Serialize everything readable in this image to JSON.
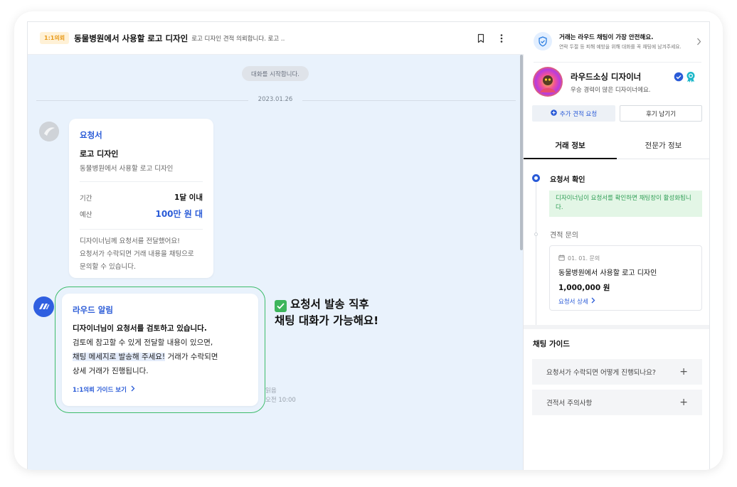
{
  "header": {
    "badge": "1:1의뢰",
    "title": "동물병원에서 사용할 로고 디자인",
    "subtitle": "로고 디자인 견적 의뢰합니다. 로고 .."
  },
  "chat": {
    "start_message": "대화를 시작합니다.",
    "date": "2023.01.26",
    "request_card": {
      "title": "요청서",
      "item": "로고 디자인",
      "description": "동물병원에서 사용할 로고 디자인",
      "period_label": "기간",
      "period_value": "1달 이내",
      "budget_label": "예산",
      "budget_value": "100만 원 대",
      "note_lines": [
        "디자이너님께 요청서를 전달했어요!",
        "요청서가 수락되면 거래 내용을 채팅으로",
        "문의할 수 있습니다."
      ]
    },
    "alert_card": {
      "title": "라우드 알림",
      "line1": "디자이너님이 요청서를 검토하고 있습니다.",
      "line2": "검토에 참고할 수 있게 전달할 내용이 있으면,",
      "line3_highlight": "채팅 메세지로 발송해 주세요!",
      "line3_rest": " 거래가 수락되면",
      "line4": "상세 거래가 진행됩니다.",
      "link": "1:1의뢰 가이드 보기"
    },
    "read_status": "읽음",
    "read_time": "오전 10:00",
    "callout_line1": "요청서 발송 직후",
    "callout_line2": "채팅 대화가 가능해요!"
  },
  "sidebar": {
    "safety_title": "거래는 라우드 채팅이 가장 안전해요.",
    "safety_sub": "연락 두절 등 피해 예방을 위해 대화를 꼭 채팅에 남겨주세요.",
    "profile_name": "라우드소싱 디자이너",
    "profile_sub": "우승 경력이 많은 디자이너에요.",
    "btn_quote": "추가 견적 요청",
    "btn_review": "후기 남기기",
    "tabs": [
      "거래 정보",
      "전문가 정보"
    ],
    "step1_title": "요청서 확인",
    "step1_msg": "디자이너님이 요청서를 확인하면 채팅창이 활성화됩니다.",
    "step2_title": "견적 문의",
    "estimate": {
      "date": "01. 01. 문의",
      "name": "동물병원에서 사용할 로고 디자인",
      "price": "1,000,000 원",
      "link": "요청서 상세"
    },
    "guide_title": "채팅 가이드",
    "faqs": [
      "요청서가 수락되면 어떻게 진행되나요?",
      "견적서 주의사항"
    ]
  },
  "colors": {
    "accent_blue": "#2a5bd7",
    "chat_bg": "#e9f2fc",
    "highlight_green": "#3dbc6b",
    "badge_orange": "#e89a1a"
  }
}
